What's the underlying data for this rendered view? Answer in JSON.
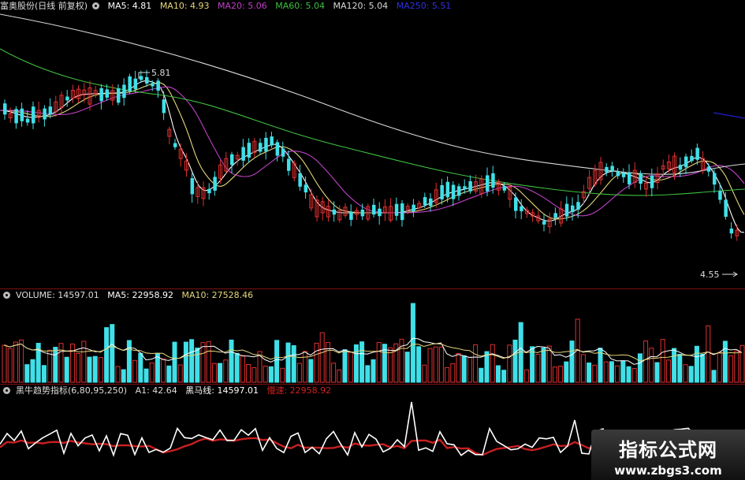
{
  "price_panel": {
    "title": "富奥股份(日线 前复权)",
    "ma5": "MA5: 4.81",
    "ma10": "MA10: 4.93",
    "ma20": "MA20: 5.06",
    "ma60": "MA60: 5.04",
    "ma120": "MA120: 5.04",
    "ma250": "MA250: 5.51",
    "high_marker": "5.81",
    "low_marker": "4.55",
    "colors": {
      "ma5": "#ffffff",
      "ma10": "#e6d67a",
      "ma20": "#c040c8",
      "ma60": "#3fbf3f",
      "ma120": "#d8d8d8",
      "ma250": "#2020d0",
      "up": "#e03030",
      "down": "#40e0e8"
    }
  },
  "volume_panel": {
    "title": "VOLUME: 14597.01",
    "ma5": "MA5: 22958.92",
    "ma10": "MA10: 27528.46"
  },
  "indicator_panel": {
    "title": "黑牛趋势指标(6,80,95,250)",
    "a1": "A1: 42.64",
    "black_horse": "黑马线: 14597.01",
    "slow": "慢速: 22958.92"
  },
  "watermark": {
    "line1": "指标公式网",
    "line2": "www.zbgs3.com"
  }
}
